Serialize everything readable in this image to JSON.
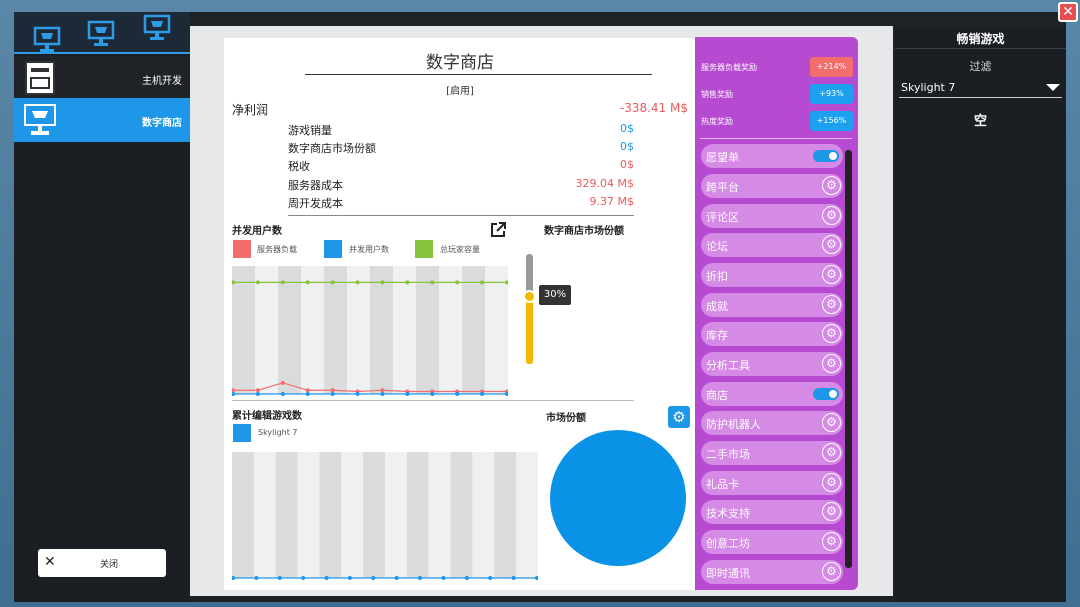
{
  "colors": {
    "accent": "#1e97e8",
    "negative": "#ec5b5b",
    "feature_panel": "#b64bd2",
    "bonus_red": "#f46d6d",
    "bonus_blue": "#1ea0f0"
  },
  "icons": {
    "tab1": "monitor-cart-icon",
    "tab2": "monitor-cart-icon",
    "tab3": "monitor-cart-icon",
    "console": "console-icon",
    "store": "monitor-cart-icon",
    "close": "close-icon",
    "popout": "external-link-icon",
    "gear": "gear-icon"
  },
  "sidebar": {
    "items": [
      {
        "label": "主机开发"
      },
      {
        "label": "数字商店"
      }
    ],
    "close_label": "关闭"
  },
  "store": {
    "title": "数字商店",
    "status": "[启用]",
    "net_profit_label": "净利润",
    "net_profit_value": "-338.41 M$",
    "rows": [
      {
        "label": "游戏销量",
        "value": "0$"
      },
      {
        "label": "数字商店市场份额",
        "value": "0$"
      },
      {
        "label": "税收",
        "value": "0$"
      },
      {
        "label": "服务器成本",
        "value": "329.04 M$"
      },
      {
        "label": "周开发成本",
        "value": "9.37 M$"
      }
    ],
    "concurrent_title": "并发用户数",
    "legend": [
      {
        "label": "服务器负载",
        "color": "#f46d6d"
      },
      {
        "label": "并发用户数",
        "color": "#1e97e8"
      },
      {
        "label": "总玩家容量",
        "color": "#86c43b"
      }
    ],
    "share_title": "数字商店市场份额",
    "share_value": "30%",
    "share_fraction": 0.3,
    "cumulative_title": "累计编辑游戏数",
    "cumulative_legend": "Skylight 7",
    "market_title": "市场份额"
  },
  "chart_data": [
    {
      "type": "line",
      "title": "并发用户数",
      "series": [
        {
          "name": "服务器负载",
          "values": [
            0.03,
            0.03,
            0.09,
            0.03,
            0.03,
            0.02,
            0.03,
            0.02,
            0.02,
            0.02,
            0.02,
            0.02
          ]
        },
        {
          "name": "并发用户数",
          "values": [
            0,
            0,
            0,
            0,
            0,
            0,
            0,
            0,
            0,
            0,
            0,
            0
          ]
        },
        {
          "name": "总玩家容量",
          "values": [
            0.9,
            0.9,
            0.9,
            0.9,
            0.9,
            0.9,
            0.9,
            0.9,
            0.9,
            0.9,
            0.9,
            0.9
          ]
        }
      ],
      "ylim": [
        0,
        1
      ]
    },
    {
      "type": "line",
      "title": "累计编辑游戏数",
      "series": [
        {
          "name": "Skylight 7",
          "values": [
            0,
            0,
            0,
            0,
            0,
            0,
            0,
            0,
            0,
            0,
            0,
            0,
            0,
            0
          ]
        }
      ],
      "ylim": [
        0,
        1
      ]
    },
    {
      "type": "pie",
      "title": "市场份额",
      "categories": [
        "Skylight 7"
      ],
      "values": [
        100
      ]
    }
  ],
  "features": {
    "bonuses": [
      {
        "label": "服务器负载奖励",
        "value": "+214%",
        "color": "#f46d6d"
      },
      {
        "label": "销售奖励",
        "value": "+93%",
        "color": "#1ea0f0"
      },
      {
        "label": "热度奖励",
        "value": "+156%",
        "color": "#1ea0f0"
      }
    ],
    "items": [
      {
        "label": "愿望单",
        "control": "toggle"
      },
      {
        "label": "跨平台",
        "control": "gear"
      },
      {
        "label": "评论区",
        "control": "gear"
      },
      {
        "label": "论坛",
        "control": "gear"
      },
      {
        "label": "折扣",
        "control": "gear"
      },
      {
        "label": "成就",
        "control": "gear"
      },
      {
        "label": "库存",
        "control": "gear"
      },
      {
        "label": "分析工具",
        "control": "gear"
      },
      {
        "label": "商店",
        "control": "toggle"
      },
      {
        "label": "防护机器人",
        "control": "gear"
      },
      {
        "label": "二手市场",
        "control": "gear"
      },
      {
        "label": "礼品卡",
        "control": "gear"
      },
      {
        "label": "技术支持",
        "control": "gear"
      },
      {
        "label": "创意工坊",
        "control": "gear"
      },
      {
        "label": "即时通讯",
        "control": "gear"
      }
    ]
  },
  "right": {
    "title": "畅销游戏",
    "filter_label": "过滤",
    "selected": "Skylight 7",
    "empty_label": "空"
  }
}
